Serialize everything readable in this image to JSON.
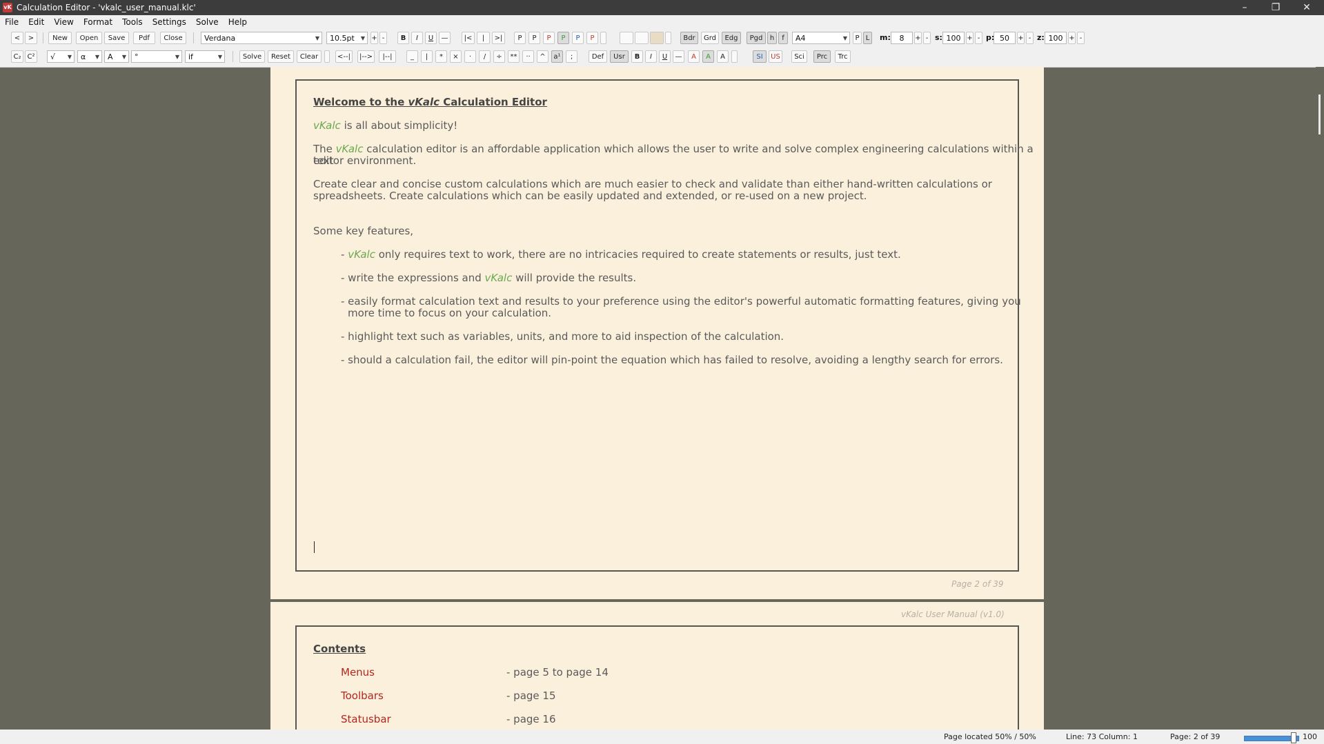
{
  "window": {
    "title": "Calculation Editor  -  'vkalc_user_manual.klc'",
    "app_icon": "vK",
    "controls": [
      "minimize-icon",
      "restore-icon",
      "close-icon"
    ]
  },
  "menu": [
    "File",
    "Edit",
    "View",
    "Format",
    "Tools",
    "Settings",
    "Solve",
    "Help"
  ],
  "toolbar1": {
    "nav": [
      "<",
      ">"
    ],
    "file": [
      "New",
      "Open",
      "Save",
      "Pdf",
      "Close"
    ],
    "font": "Verdana",
    "size": "10.5pt",
    "size_step": [
      "+",
      "-"
    ],
    "style": [
      "B",
      "I",
      "U",
      "—"
    ],
    "indent": [
      "|<",
      "|",
      ">|"
    ],
    "p_buttons": [
      "P",
      "P",
      "P",
      "P",
      "P",
      "P"
    ],
    "view": [
      "Bdr",
      "Grd",
      "Edg",
      "Pgd",
      "h",
      "f"
    ],
    "paper": "A4",
    "orient": [
      "P",
      "L"
    ],
    "m_label": "m:",
    "m_value": "8",
    "s_label": "s:",
    "s_value": "100",
    "p_label": "p:",
    "p_value": "50",
    "z_label": "z:",
    "z_value": "100",
    "step": [
      "+",
      "-"
    ]
  },
  "toolbar2": {
    "sub_sup": [
      "C₂",
      "C²"
    ],
    "combos": [
      "√",
      "α",
      "A",
      "°",
      "if"
    ],
    "solve": [
      "Solve",
      "Reset",
      "Clear"
    ],
    "arrows": [
      "<--|",
      "|-->",
      "|--|"
    ],
    "ops": [
      "_",
      "|",
      "*",
      "×",
      "·",
      "/",
      "÷",
      "**",
      "··",
      "^",
      "a¹",
      ";"
    ],
    "fmt": [
      "Def",
      "Usr",
      "B",
      "I",
      "U",
      "—",
      "A",
      "A",
      "A"
    ],
    "units": [
      "SI",
      "US"
    ],
    "mode": [
      "Sci",
      "Prc",
      "Trc"
    ]
  },
  "doc": {
    "title_a": "Welcome to the ",
    "title_b": "vKalc",
    "title_c": " Calculation Editor",
    "p1_a": "vKalc",
    "p1_b": " is all about simplicity!",
    "p2_a": "The ",
    "p2_b": "vKalc",
    "p2_c": " calculation editor is an affordable application which allows the user to write and solve complex engineering calculations within a text",
    "p2_d": "editor environment.",
    "p3_a": "Create clear and concise custom calculations which are much easier to check and validate than either hand-written calculations or",
    "p3_b": "spreadsheets. Create calculations which can be easily updated and extended, or re-used on a new project.",
    "features": "Some key features,",
    "b1_a": "- ",
    "b1_b": "vKalc",
    "b1_c": " only requires text to work, there are no intricacies required to create statements or results, just text.",
    "b2_a": "- write the expressions and ",
    "b2_b": "vKalc",
    "b2_c": " will provide the results.",
    "b3_a": "- easily format calculation text and results to your preference using the editor's powerful automatic formatting features, giving you",
    "b3_b": "more time to focus on your calculation.",
    "b4": "- highlight text such as variables, units, and more to aid inspection of the calculation.",
    "b5": "- should a calculation fail, the editor will pin-point the equation which has failed to resolve, avoiding a lengthy search for errors.",
    "footer1": "Page 2 of 39",
    "header2": "vKalc User Manual (v1.0)",
    "contents": "Contents",
    "toc": [
      {
        "name": "Menus",
        "pages": "- page 5 to page 14"
      },
      {
        "name": "Toolbars",
        "pages": "- page 15"
      },
      {
        "name": "Statusbar",
        "pages": "- page 16"
      }
    ]
  },
  "status": {
    "located": "Page located 50% / 50%",
    "line": "Line: 73  Column: 1",
    "page": "Page: 2 of 39",
    "zoom": "100",
    "zoom_fraction": 1.0
  },
  "colors": {
    "page": "#fbf0dc",
    "desk": "#66665a",
    "highlight": "#6aa84f",
    "link": "#b3261e"
  }
}
